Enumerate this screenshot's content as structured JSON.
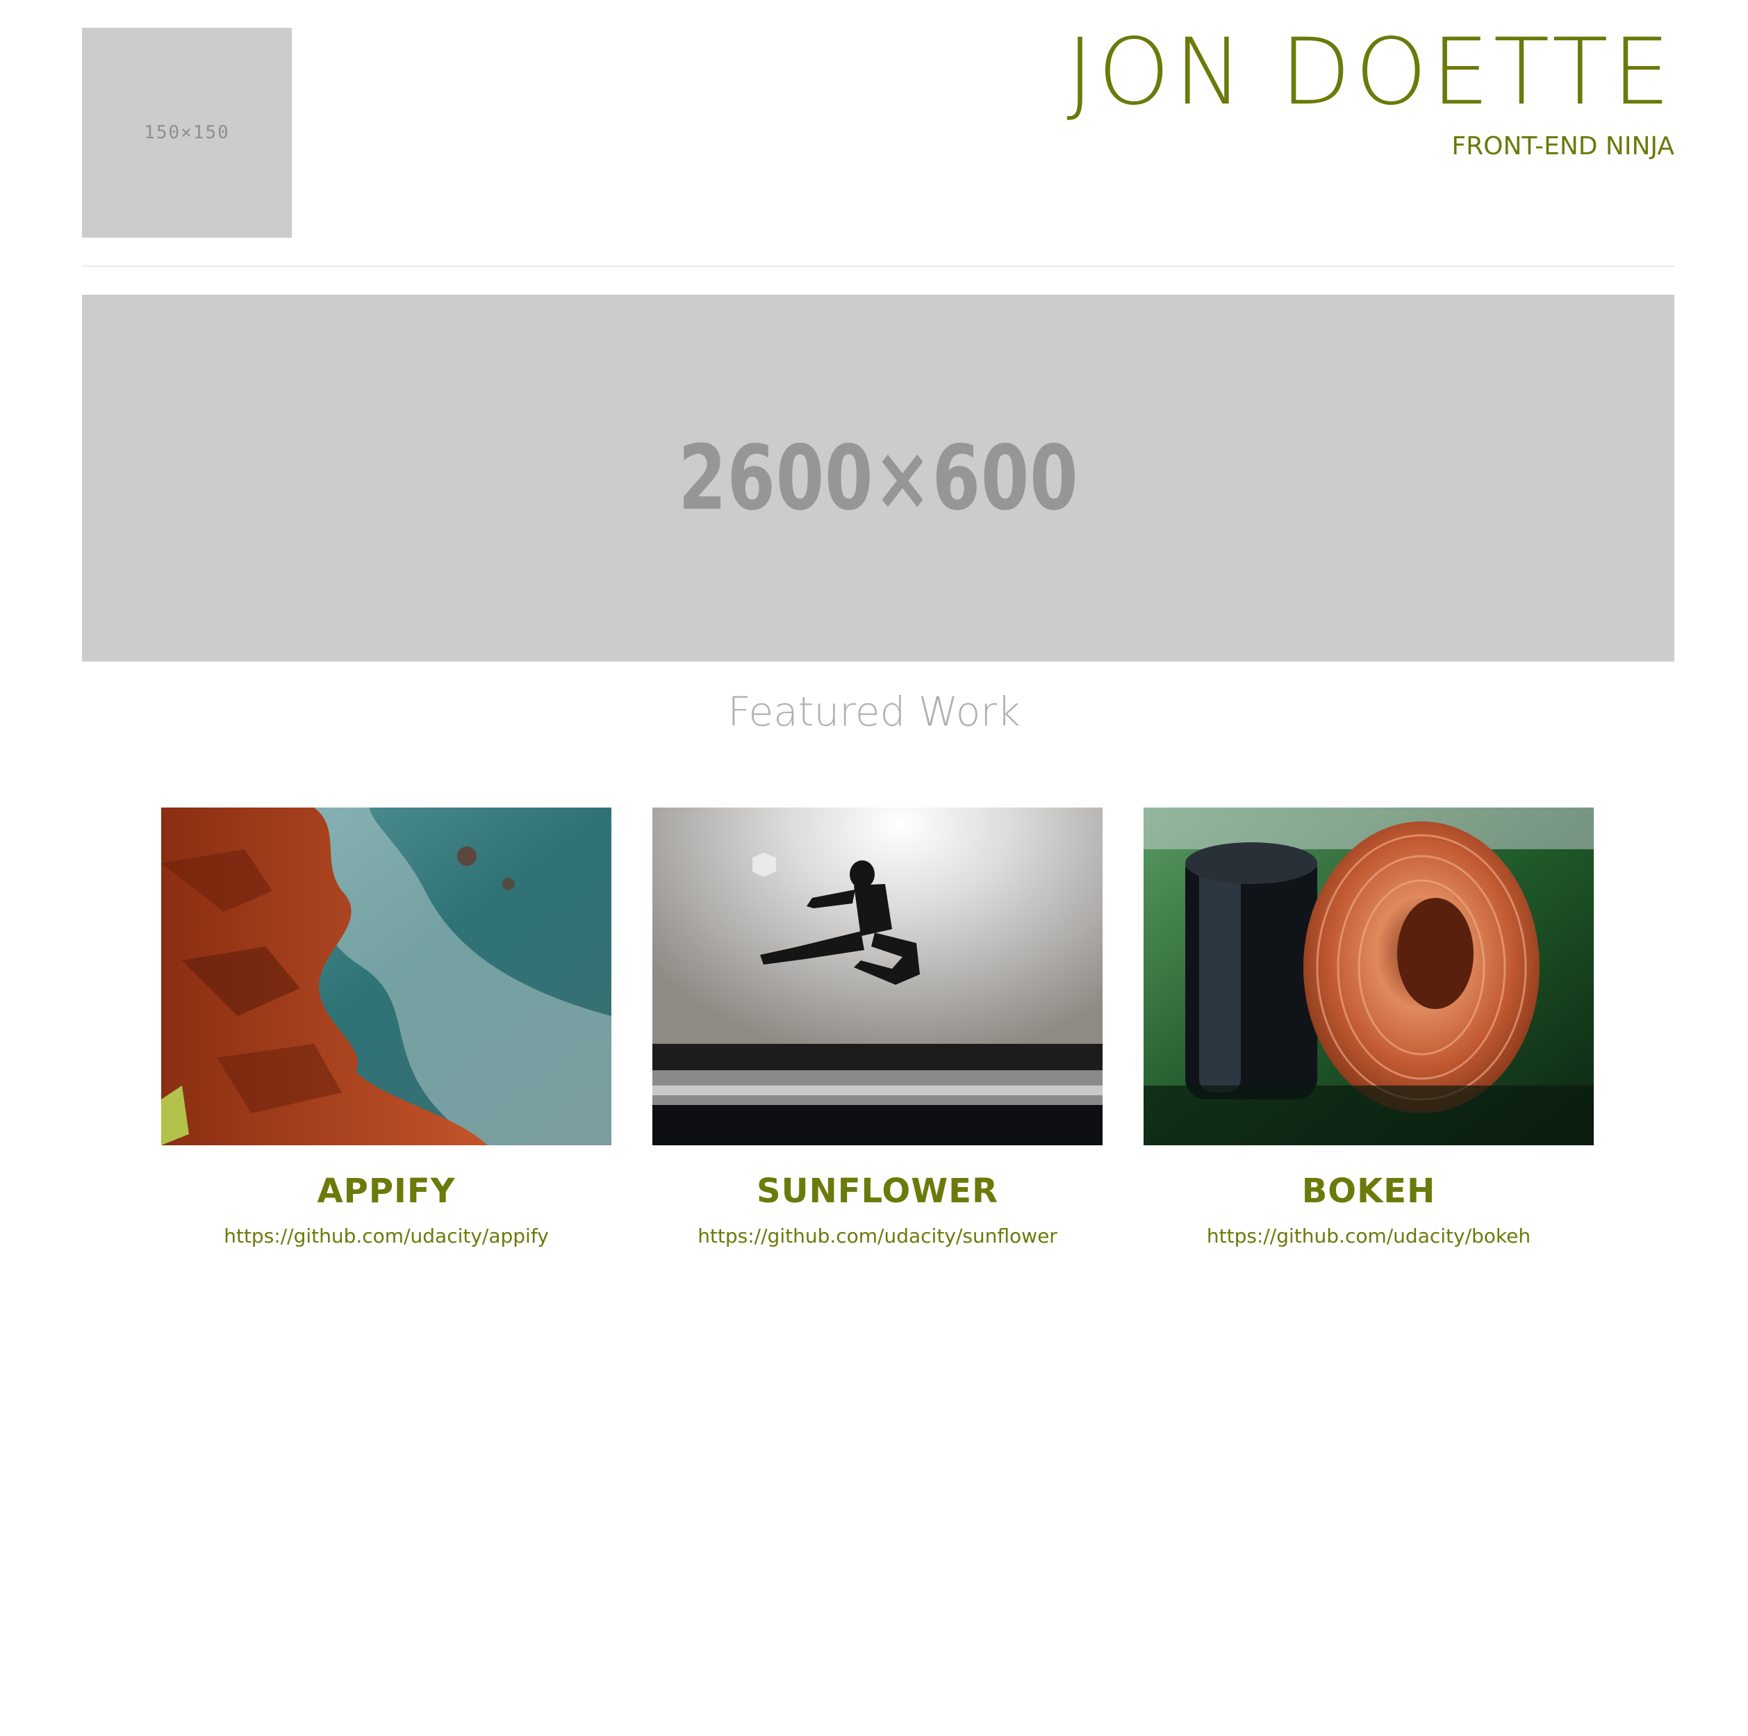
{
  "header": {
    "logo_placeholder": "150×150",
    "name": "JON DOETTE",
    "tagline": "FRONT-END NINJA"
  },
  "hero": {
    "placeholder": "2600×600"
  },
  "featured": {
    "title": "Featured Work",
    "projects": [
      {
        "title": "APPIFY",
        "link": "https://github.com/udacity/appify"
      },
      {
        "title": "SUNFLOWER",
        "link": "https://github.com/udacity/sunflower"
      },
      {
        "title": "BOKEH",
        "link": "https://github.com/udacity/bokeh"
      }
    ]
  },
  "colors": {
    "accent": "#6b7a0a",
    "placeholder_bg": "#cccccc",
    "placeholder_text": "#969696",
    "section_title": "#b0b0b0"
  }
}
